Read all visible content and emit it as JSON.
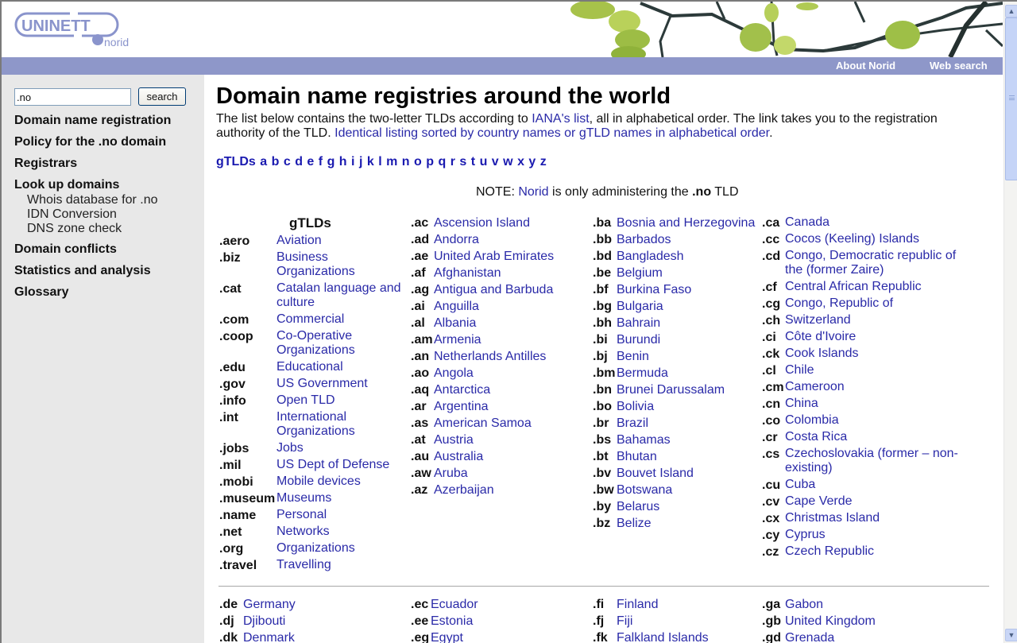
{
  "header": {
    "logo_text": "UNINETT",
    "logo_sub": "norid",
    "nav": [
      {
        "label": "About Norid"
      },
      {
        "label": "Web search"
      }
    ]
  },
  "sidebar": {
    "search_value": ".no",
    "search_button": "search",
    "menu": [
      {
        "label": "Domain name registration"
      },
      {
        "label": "Policy for the .no domain"
      },
      {
        "label": "Registrars"
      },
      {
        "label": "Look up domains",
        "sub": [
          {
            "label": "Whois database for .no"
          },
          {
            "label": "IDN Conversion"
          },
          {
            "label": "DNS zone check"
          }
        ]
      },
      {
        "label": "Domain conflicts"
      },
      {
        "label": "Statistics and analysis"
      },
      {
        "label": "Glossary"
      }
    ]
  },
  "main": {
    "title": "Domain name registries around the world",
    "intro_before_link": "The list below contains the two-letter TLDs according to ",
    "intro_link": "IANA's list",
    "intro_after_link": ", all in alphabetical order. The link takes you to the registration authority of the TLD. ",
    "intro_link2": "Identical listing sorted by country names or gTLD names in alphabetical order",
    "intro_end": ".",
    "letters": [
      "gTLDs",
      "a",
      "b",
      "c",
      "d",
      "e",
      "f",
      "g",
      "h",
      "i",
      "j",
      "k",
      "l",
      "m",
      "n",
      "o",
      "p",
      "q",
      "r",
      "s",
      "t",
      "u",
      "v",
      "w",
      "x",
      "y",
      "z"
    ],
    "note_prefix": "NOTE: ",
    "note_link": "Norid",
    "note_middle": " is only administering the ",
    "note_bold": ".no",
    "note_suffix": " TLD",
    "gtld_heading": "gTLDs",
    "gtlds": [
      {
        "code": ".aero",
        "name": "Aviation"
      },
      {
        "code": ".biz",
        "name": "Business Organizations"
      },
      {
        "code": ".cat",
        "name": "Catalan language and culture"
      },
      {
        "code": ".com",
        "name": "Commercial"
      },
      {
        "code": ".coop",
        "name": "Co-Operative Organizations"
      },
      {
        "code": ".edu",
        "name": "Educational"
      },
      {
        "code": ".gov",
        "name": "US Government"
      },
      {
        "code": ".info",
        "name": "Open TLD"
      },
      {
        "code": ".int",
        "name": "International Organizations"
      },
      {
        "code": ".jobs",
        "name": "Jobs"
      },
      {
        "code": ".mil",
        "name": "US Dept of Defense"
      },
      {
        "code": ".mobi",
        "name": "Mobile devices"
      },
      {
        "code": ".museum",
        "name": "Museums"
      },
      {
        "code": ".name",
        "name": "Personal"
      },
      {
        "code": ".net",
        "name": "Networks"
      },
      {
        "code": ".org",
        "name": "Organizations"
      },
      {
        "code": ".travel",
        "name": "Travelling"
      }
    ],
    "a": [
      {
        "code": ".ac",
        "name": "Ascension Island"
      },
      {
        "code": ".ad",
        "name": "Andorra"
      },
      {
        "code": ".ae",
        "name": "United Arab Emirates"
      },
      {
        "code": ".af",
        "name": "Afghanistan"
      },
      {
        "code": ".ag",
        "name": "Antigua and Barbuda"
      },
      {
        "code": ".ai",
        "name": "Anguilla"
      },
      {
        "code": ".al",
        "name": "Albania"
      },
      {
        "code": ".am",
        "name": "Armenia"
      },
      {
        "code": ".an",
        "name": "Netherlands Antilles"
      },
      {
        "code": ".ao",
        "name": "Angola"
      },
      {
        "code": ".aq",
        "name": "Antarctica"
      },
      {
        "code": ".ar",
        "name": "Argentina"
      },
      {
        "code": ".as",
        "name": "American Samoa"
      },
      {
        "code": ".at",
        "name": "Austria"
      },
      {
        "code": ".au",
        "name": "Australia"
      },
      {
        "code": ".aw",
        "name": "Aruba"
      },
      {
        "code": ".az",
        "name": "Azerbaijan"
      }
    ],
    "b": [
      {
        "code": ".ba",
        "name": "Bosnia and Herzegovina"
      },
      {
        "code": ".bb",
        "name": "Barbados"
      },
      {
        "code": ".bd",
        "name": "Bangladesh"
      },
      {
        "code": ".be",
        "name": "Belgium"
      },
      {
        "code": ".bf",
        "name": "Burkina Faso"
      },
      {
        "code": ".bg",
        "name": "Bulgaria"
      },
      {
        "code": ".bh",
        "name": "Bahrain"
      },
      {
        "code": ".bi",
        "name": "Burundi"
      },
      {
        "code": ".bj",
        "name": "Benin"
      },
      {
        "code": ".bm",
        "name": "Bermuda"
      },
      {
        "code": ".bn",
        "name": "Brunei Darussalam"
      },
      {
        "code": ".bo",
        "name": "Bolivia"
      },
      {
        "code": ".br",
        "name": "Brazil"
      },
      {
        "code": ".bs",
        "name": "Bahamas"
      },
      {
        "code": ".bt",
        "name": "Bhutan"
      },
      {
        "code": ".bv",
        "name": "Bouvet Island"
      },
      {
        "code": ".bw",
        "name": "Botswana"
      },
      {
        "code": ".by",
        "name": "Belarus"
      },
      {
        "code": ".bz",
        "name": "Belize"
      }
    ],
    "c": [
      {
        "code": ".ca",
        "name": "Canada"
      },
      {
        "code": ".cc",
        "name": "Cocos (Keeling) Islands"
      },
      {
        "code": ".cd",
        "name": "Congo, Democratic republic of the (former Zaire)"
      },
      {
        "code": ".cf",
        "name": "Central African Republic"
      },
      {
        "code": ".cg",
        "name": "Congo, Republic of"
      },
      {
        "code": ".ch",
        "name": "Switzerland"
      },
      {
        "code": ".ci",
        "name": "Côte d'Ivoire"
      },
      {
        "code": ".ck",
        "name": "Cook Islands"
      },
      {
        "code": ".cl",
        "name": "Chile"
      },
      {
        "code": ".cm",
        "name": "Cameroon"
      },
      {
        "code": ".cn",
        "name": "China"
      },
      {
        "code": ".co",
        "name": "Colombia"
      },
      {
        "code": ".cr",
        "name": "Costa Rica"
      },
      {
        "code": ".cs",
        "name": "Czechoslovakia (former – non-existing)"
      },
      {
        "code": ".cu",
        "name": "Cuba"
      },
      {
        "code": ".cv",
        "name": "Cape Verde"
      },
      {
        "code": ".cx",
        "name": "Christmas Island"
      },
      {
        "code": ".cy",
        "name": "Cyprus"
      },
      {
        "code": ".cz",
        "name": "Czech Republic"
      }
    ],
    "d": [
      {
        "code": ".de",
        "name": "Germany"
      },
      {
        "code": ".dj",
        "name": "Djibouti"
      },
      {
        "code": ".dk",
        "name": "Denmark"
      }
    ],
    "e": [
      {
        "code": ".ec",
        "name": "Ecuador"
      },
      {
        "code": ".ee",
        "name": "Estonia"
      },
      {
        "code": ".eg",
        "name": "Egypt"
      }
    ],
    "f": [
      {
        "code": ".fi",
        "name": "Finland"
      },
      {
        "code": ".fj",
        "name": "Fiji"
      },
      {
        "code": ".fk",
        "name": "Falkland Islands"
      }
    ],
    "g": [
      {
        "code": ".ga",
        "name": "Gabon"
      },
      {
        "code": ".gb",
        "name": "United Kingdom"
      },
      {
        "code": ".gd",
        "name": "Grenada"
      }
    ]
  },
  "colors": {
    "navbar": "#8e97c9",
    "sidebar": "#e8e8e8",
    "link": "#2a2aa8",
    "logo": "#8a94cc"
  }
}
